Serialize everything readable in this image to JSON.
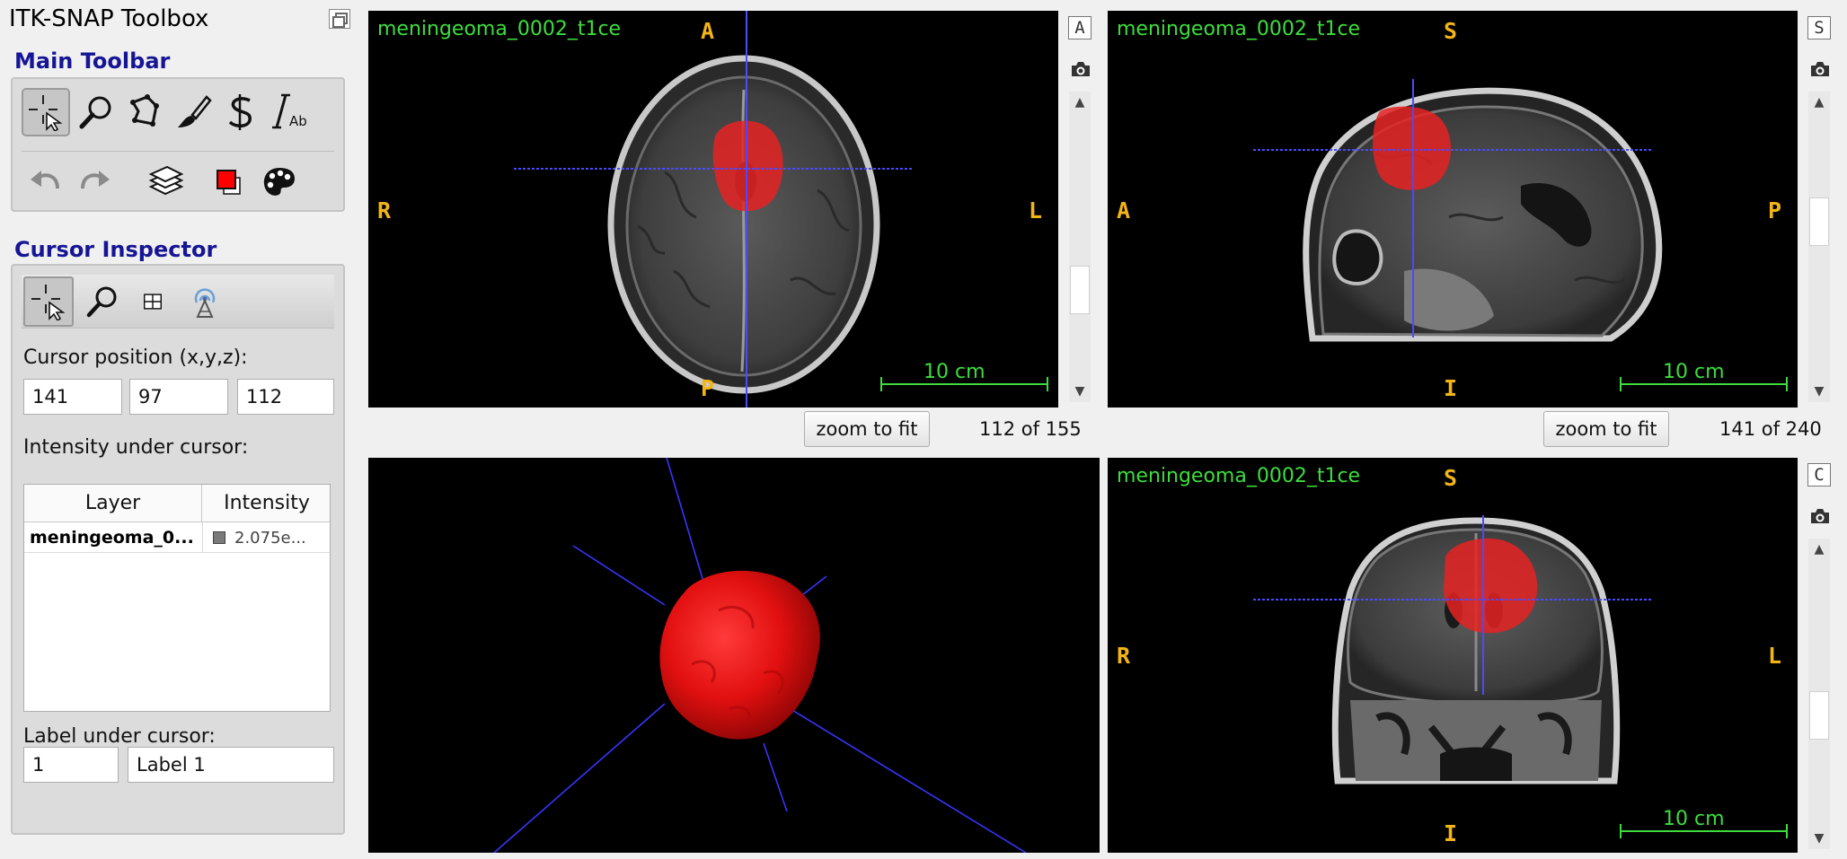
{
  "toolbox": {
    "title": "ITK-SNAP Toolbox",
    "main_toolbar_title": "Main Toolbar",
    "cursor_inspector_title": "Cursor Inspector",
    "main_tools": [
      {
        "name": "crosshair-tool",
        "active": true
      },
      {
        "name": "zoom-tool",
        "active": false
      },
      {
        "name": "polygon-tool",
        "active": false
      },
      {
        "name": "paintbrush-tool",
        "active": false
      },
      {
        "name": "snake-tool",
        "active": false
      },
      {
        "name": "annotation-tool",
        "active": false
      }
    ],
    "secondary_tools": [
      "undo",
      "redo",
      "layers",
      "active-label-color",
      "label-palette"
    ],
    "active_label_color": "#ff0000",
    "inspector_tabs": [
      "cursor-position-tab",
      "zoom-tab",
      "grid-tab",
      "sync-tab"
    ]
  },
  "cursor_inspector": {
    "position_label": "Cursor position (x,y,z):",
    "x": "141",
    "y": "97",
    "z": "112",
    "intensity_label": "Intensity under cursor:",
    "table_headers": [
      "Layer",
      "Intensity"
    ],
    "rows": [
      {
        "layer": "meningeoma_0...",
        "intensity": "2.075e..."
      }
    ],
    "label_under_cursor_label": "Label under cursor:",
    "label_id": "1",
    "label_name": "Label 1"
  },
  "views": {
    "axial": {
      "image_name": "meningeoma_0002_t1ce",
      "top": "A",
      "bottom": "P",
      "left": "R",
      "right": "L",
      "scale": "10 cm",
      "slice": "112 of 155",
      "button_letter": "A",
      "zoom_label": "zoom to fit"
    },
    "sagittal": {
      "image_name": "meningeoma_0002_t1ce",
      "top": "S",
      "bottom": "I",
      "left": "A",
      "right": "P",
      "scale": "10 cm",
      "slice": "141 of 240",
      "button_letter": "S",
      "zoom_label": "zoom to fit"
    },
    "coronal": {
      "image_name": "meningeoma_0002_t1ce",
      "top": "S",
      "bottom": "I",
      "left": "R",
      "right": "L",
      "scale": "10 cm",
      "button_letter": "C"
    },
    "three_d": {}
  },
  "colors": {
    "segmentation": "#e52222",
    "crosshair": "#4a4aff",
    "image_name": "#3ddd3d",
    "orientation": "#f2b416",
    "section_title": "#151595"
  }
}
